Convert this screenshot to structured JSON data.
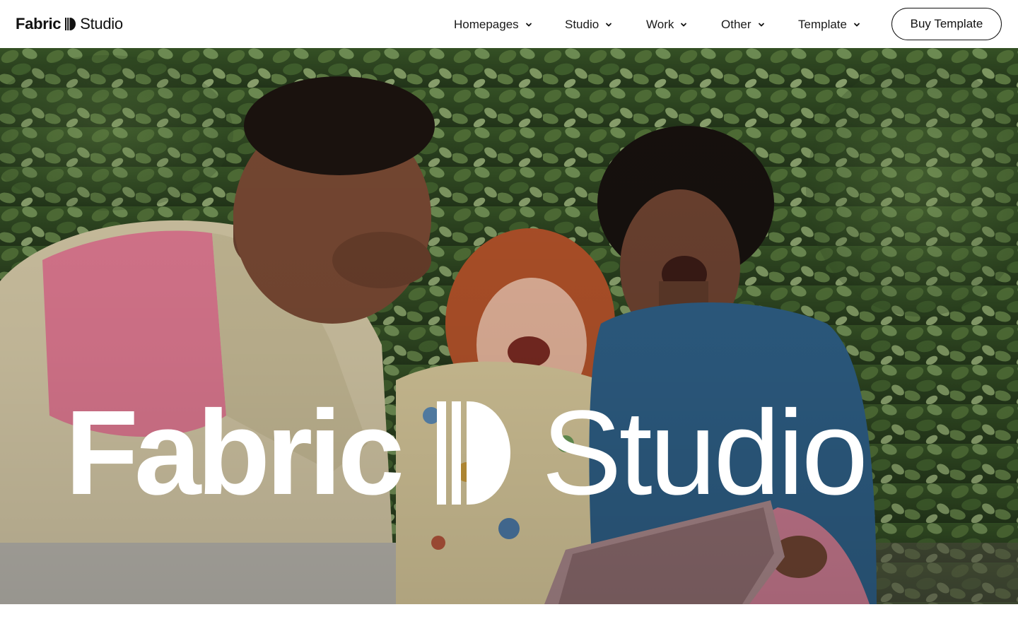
{
  "brand": {
    "logo_bold": "Fabric",
    "logo_light": "Studio",
    "logo_mark_icon": "fabric-d-logo-icon"
  },
  "nav": {
    "items": [
      {
        "label": "Homepages",
        "icon": "chevron-down-icon"
      },
      {
        "label": "Studio",
        "icon": "chevron-down-icon"
      },
      {
        "label": "Work",
        "icon": "chevron-down-icon"
      },
      {
        "label": "Other",
        "icon": "chevron-down-icon"
      },
      {
        "label": "Template",
        "icon": "chevron-down-icon"
      }
    ],
    "cta_label": "Buy Template"
  },
  "hero": {
    "title_bold": "Fabric",
    "title_light": "Studio",
    "image_subject": "three friends laughing in front of a green ivy wall, one holding a tablet"
  },
  "colors": {
    "text": "#111111",
    "background": "#ffffff",
    "hero_text": "#ffffff",
    "foliage": "#3f5f2c"
  }
}
